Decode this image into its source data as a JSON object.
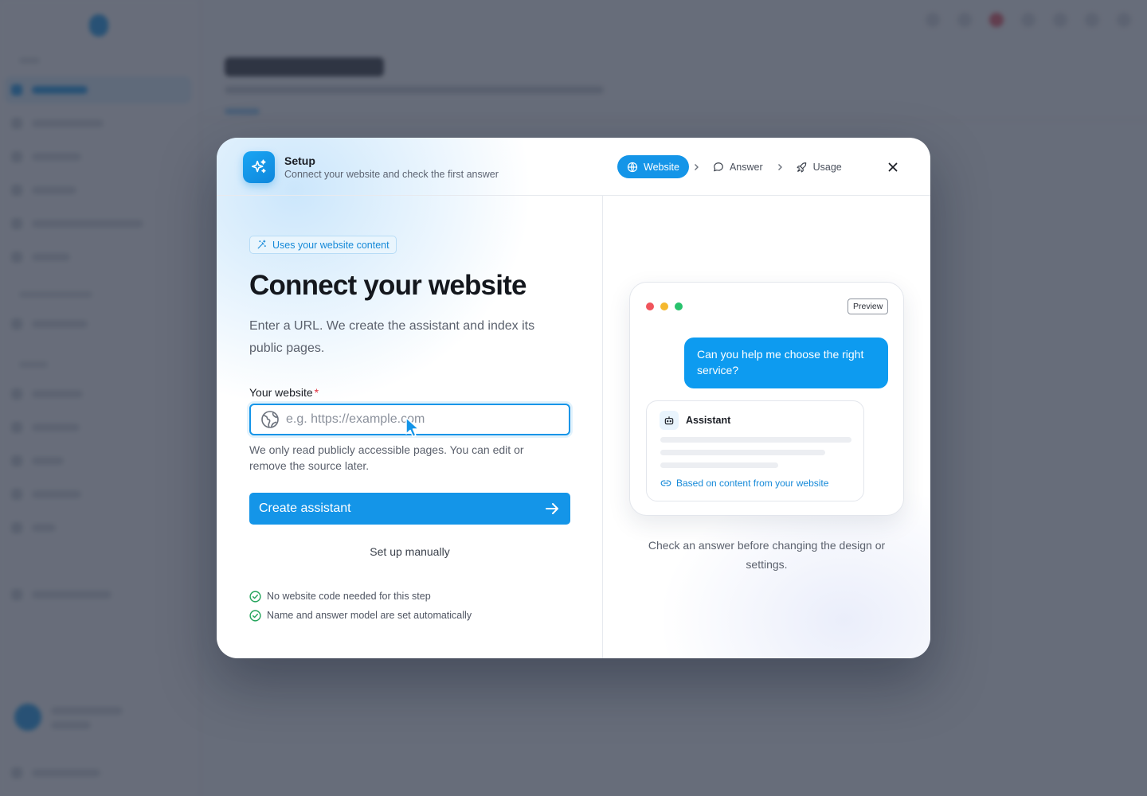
{
  "modal": {
    "title": "Setup",
    "subtitle": "Connect your website and check the first answer",
    "header_icon": "sparkles-icon",
    "steps": [
      {
        "label": "Website",
        "icon": "globe-icon",
        "active": true
      },
      {
        "label": "Answer",
        "icon": "chat-bubble-icon",
        "active": false
      },
      {
        "label": "Usage",
        "icon": "rocket-icon",
        "active": false
      }
    ],
    "close_icon": "close-icon"
  },
  "form": {
    "badge": "Uses your website content",
    "heading": "Connect your website",
    "lead": "Enter a URL. We create the assistant and index its public pages.",
    "field_label": "Your website",
    "required_mark": "*",
    "url_value": "",
    "url_placeholder": "e.g. https://example.com",
    "hint": "We only read publicly accessible pages. You can edit or remove the source later.",
    "primary_button": "Create assistant",
    "secondary_button": "Set up manually",
    "checks": [
      "No website code needed for this step",
      "Name and answer model are set automatically"
    ]
  },
  "preview": {
    "tag": "Preview",
    "user_message": "Can you help me choose the right service?",
    "assistant_name": "Assistant",
    "assistant_icon": "robot-icon",
    "source_note": "Based on content from your website",
    "caption": "Check an answer before changing the design or settings."
  },
  "colors": {
    "accent": "#1495e8",
    "success": "#22a35a",
    "dot_red": "#f0545c",
    "dot_yellow": "#f5b82e",
    "dot_green": "#27c26c"
  }
}
